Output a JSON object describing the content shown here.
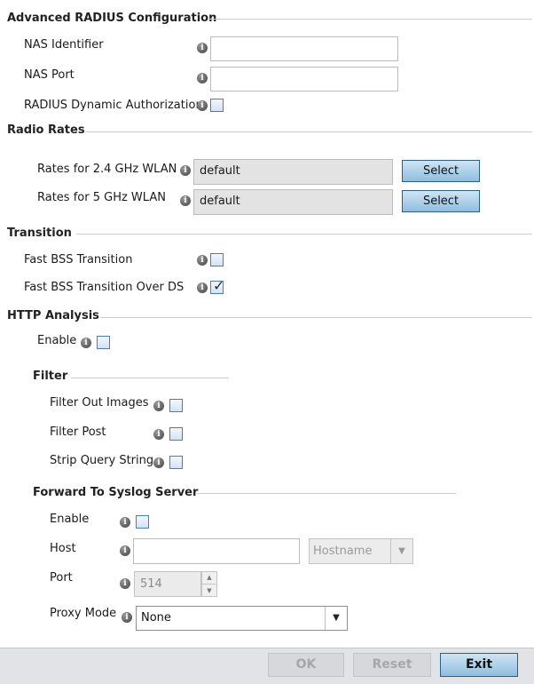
{
  "sections": {
    "advanced_radius": "Advanced RADIUS Configuration",
    "radio_rates": "Radio Rates",
    "transition": "Transition",
    "http_analysis": "HTTP Analysis",
    "filter": "Filter",
    "forward_syslog": "Forward To Syslog Server"
  },
  "radius": {
    "nas_identifier_label": "NAS Identifier",
    "nas_identifier_value": "",
    "nas_port_label": "NAS Port",
    "nas_port_value": "",
    "dynamic_auth_label": "RADIUS Dynamic Authorization",
    "dynamic_auth_checked": false
  },
  "rates": {
    "rate_24_label": "Rates for 2.4 GHz WLAN",
    "rate_24_value": "default",
    "rate_5_label": "Rates for 5 GHz WLAN",
    "rate_5_value": "default",
    "select_label": "Select"
  },
  "transition": {
    "fast_bss_label": "Fast BSS Transition",
    "fast_bss_checked": false,
    "fast_bss_ds_label": "Fast BSS Transition Over DS",
    "fast_bss_ds_checked": true
  },
  "http": {
    "enable_label": "Enable",
    "enable_checked": false,
    "filter_images_label": "Filter Out Images",
    "filter_post_label": "Filter Post",
    "strip_query_label": "Strip Query String"
  },
  "syslog": {
    "enable_label": "Enable",
    "host_label": "Host",
    "host_value": "",
    "host_type": "Hostname",
    "port_label": "Port",
    "port_value": "514",
    "proxy_label": "Proxy Mode",
    "proxy_value": "None"
  },
  "footer": {
    "ok_label": "OK",
    "reset_label": "Reset",
    "exit_label": "Exit"
  },
  "icons": {
    "info": "info-icon",
    "check": "checkmark-icon",
    "dropdown": "chevron-down-icon"
  }
}
